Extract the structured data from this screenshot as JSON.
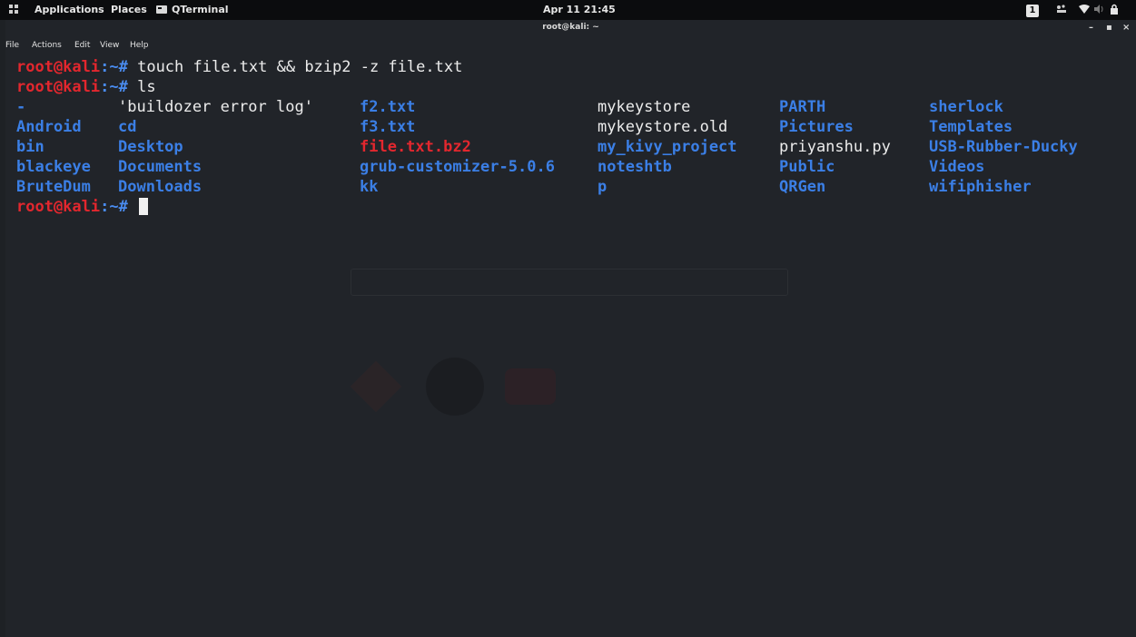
{
  "topbar": {
    "applications": "Applications",
    "places": "Places",
    "active_app": "QTerminal",
    "clock": "Apr 11 21:45",
    "workspace": "1"
  },
  "window": {
    "title": "root@kali: ~",
    "menu": [
      "File",
      "Actions",
      "Edit",
      "View",
      "Help"
    ]
  },
  "terminal": {
    "prompt_user": "root@kali",
    "prompt_path": ":~#",
    "commands": [
      "touch file.txt && bzip2 -z file.txt",
      "ls"
    ],
    "ls_columns": [
      [
        {
          "name": "-",
          "type": "dir"
        },
        {
          "name": "Android",
          "type": "dir"
        },
        {
          "name": "bin",
          "type": "dir"
        },
        {
          "name": "blackeye",
          "type": "dir"
        },
        {
          "name": "BruteDum",
          "type": "dir"
        }
      ],
      [
        {
          "name": "'buildozer error log'",
          "type": "file"
        },
        {
          "name": "cd",
          "type": "dir"
        },
        {
          "name": "Desktop",
          "type": "dir"
        },
        {
          "name": "Documents",
          "type": "dir"
        },
        {
          "name": "Downloads",
          "type": "dir"
        }
      ],
      [
        {
          "name": "f2.txt",
          "type": "dir"
        },
        {
          "name": "f3.txt",
          "type": "dir"
        },
        {
          "name": "file.txt.bz2",
          "type": "archive"
        },
        {
          "name": "grub-customizer-5.0.6",
          "type": "dir"
        },
        {
          "name": "kk",
          "type": "dir"
        }
      ],
      [
        {
          "name": "mykeystore",
          "type": "file"
        },
        {
          "name": "mykeystore.old",
          "type": "file"
        },
        {
          "name": "my_kivy_project",
          "type": "dir"
        },
        {
          "name": "noteshtb",
          "type": "dir"
        },
        {
          "name": "p",
          "type": "dir"
        }
      ],
      [
        {
          "name": "PARTH",
          "type": "dir"
        },
        {
          "name": "Pictures",
          "type": "dir"
        },
        {
          "name": "priyanshu.py",
          "type": "file"
        },
        {
          "name": "Public",
          "type": "dir"
        },
        {
          "name": "QRGen",
          "type": "dir"
        }
      ],
      [
        {
          "name": "sherlock",
          "type": "dir"
        },
        {
          "name": "Templates",
          "type": "dir"
        },
        {
          "name": "USB-Rubber-Ducky",
          "type": "dir"
        },
        {
          "name": "Videos",
          "type": "dir"
        },
        {
          "name": "wifiphisher",
          "type": "dir"
        }
      ]
    ]
  },
  "colors": {
    "prompt": "#e3272e",
    "directory": "#3b7fe6",
    "archive": "#e3272e",
    "text": "#ececec",
    "background": "#212429"
  }
}
